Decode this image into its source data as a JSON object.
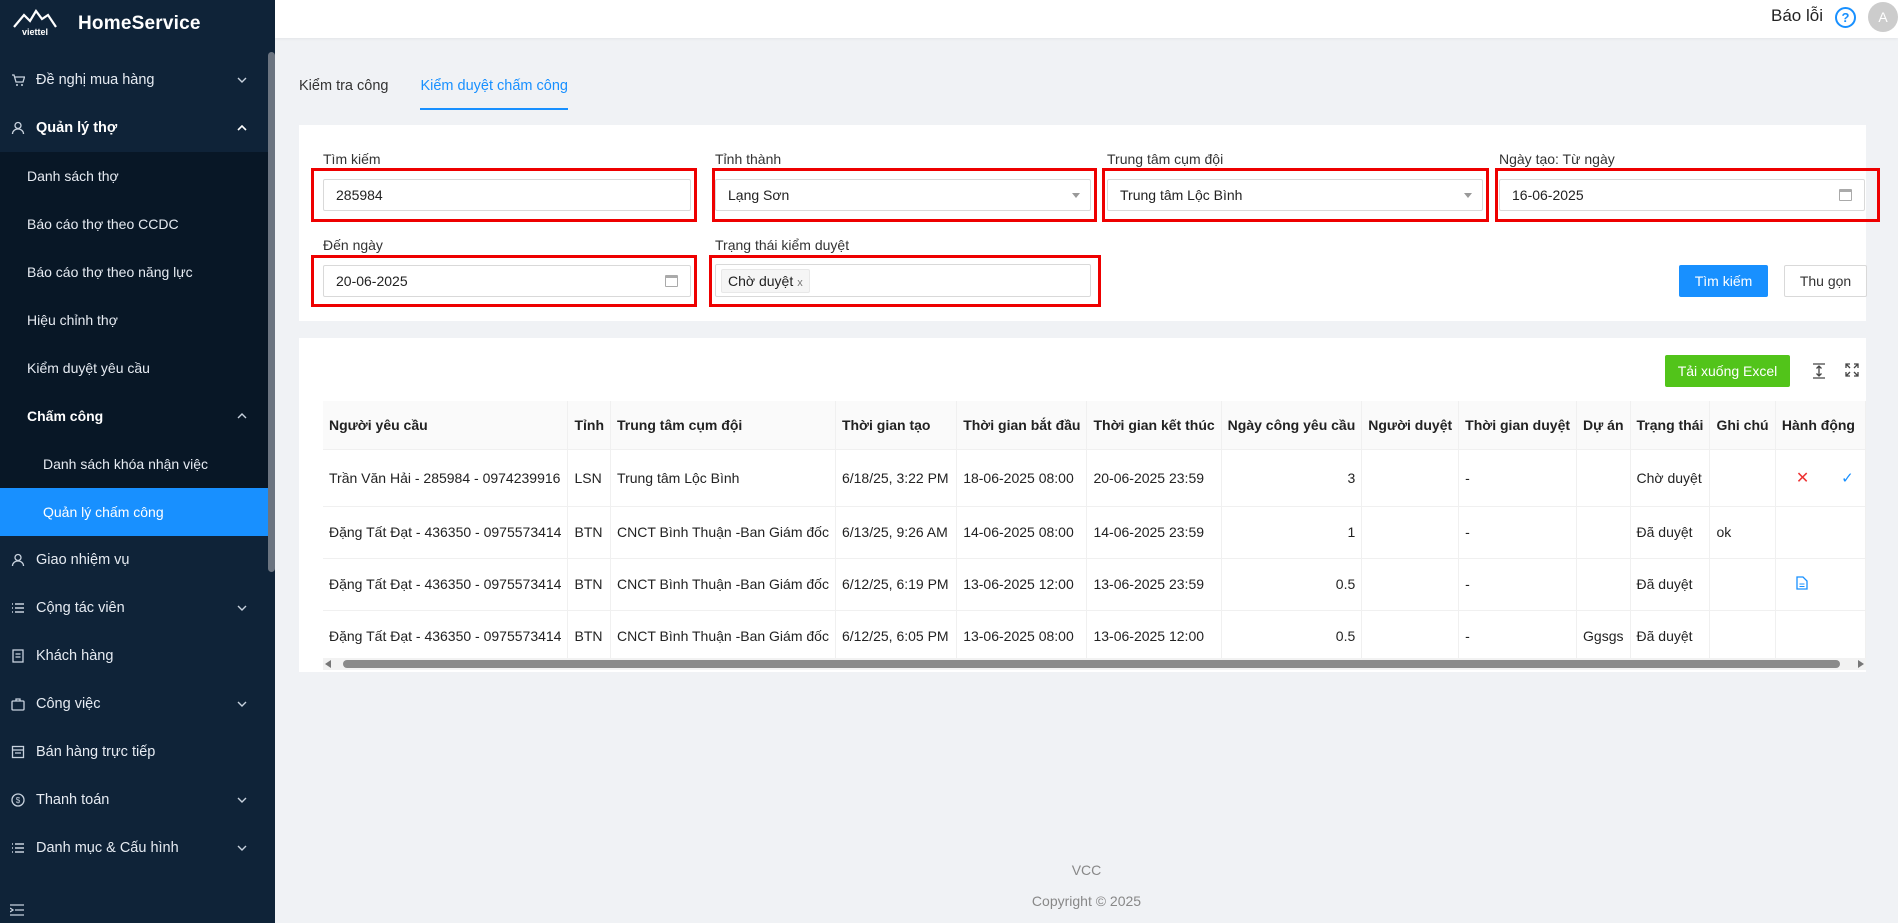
{
  "app": {
    "title": "HomeService",
    "logo_text": "viettel"
  },
  "sidebar": {
    "items": [
      {
        "label": "Đề nghị mua hàng",
        "icon": "cart-icon"
      },
      {
        "label": "Quản lý thợ",
        "icon": "user-icon"
      },
      {
        "label": "Danh sách thợ"
      },
      {
        "label": "Báo cáo thợ theo CCDC"
      },
      {
        "label": "Báo cáo thợ theo năng lực"
      },
      {
        "label": "Hiệu chỉnh thợ"
      },
      {
        "label": "Kiểm duyệt yêu cầu"
      },
      {
        "label": "Chấm công"
      },
      {
        "label": "Danh sách khóa nhận việc"
      },
      {
        "label": "Quản lý chấm công"
      },
      {
        "label": "Giao nhiệm vụ",
        "icon": "user-task-icon"
      },
      {
        "label": "Cộng tác viên",
        "icon": "list-icon"
      },
      {
        "label": "Khách hàng",
        "icon": "document-icon"
      },
      {
        "label": "Công việc",
        "icon": "bag-icon"
      },
      {
        "label": "Bán hàng trực tiếp",
        "icon": "store-icon"
      },
      {
        "label": "Thanh toán",
        "icon": "dollar-icon"
      },
      {
        "label": "Danh mục & Cấu hình",
        "icon": "list-icon"
      }
    ]
  },
  "header": {
    "report_label": "Báo lỗi",
    "help_glyph": "?",
    "avatar_letter": "A"
  },
  "tabs": [
    {
      "label": "Kiểm tra công"
    },
    {
      "label": "Kiểm duyệt chấm công"
    }
  ],
  "filters": {
    "search": {
      "label": "Tìm kiếm",
      "value": "285984"
    },
    "province": {
      "label": "Tỉnh thành",
      "value": "Lạng Sơn"
    },
    "center": {
      "label": "Trung tâm cụm đội",
      "value": "Trung tâm Lộc Bình"
    },
    "from_date": {
      "label": "Ngày tạo: Từ ngày",
      "value": "16-06-2025"
    },
    "to_date": {
      "label": "Đến ngày",
      "value": "20-06-2025"
    },
    "status": {
      "label": "Trạng thái kiểm duyệt",
      "tag": "Chờ duyệt",
      "tag_close": "x"
    },
    "search_button": "Tìm kiếm",
    "collapse_button": "Thu gọn"
  },
  "toolbar": {
    "excel_button": "Tải xuống Excel",
    "density_glyph": "⇕",
    "fullscreen_glyph": "⤢"
  },
  "table": {
    "headers": [
      "Người yêu cầu",
      "Tỉnh",
      "Trung tâm cụm đội",
      "Thời gian tạo",
      "Thời gian bắt đầu",
      "Thời gian kết thúc",
      "Ngày công yêu cầu",
      "Người duyệt",
      "Thời gian duyệt",
      "Dự án",
      "Trạng thái",
      "Ghi chú",
      "Hành động"
    ],
    "rows": [
      [
        "Trần Văn Hải - 285984 - 0974239916",
        "LSN",
        "Trung tâm Lộc Bình",
        "6/18/25, 3:22 PM",
        "18-06-2025 08:00",
        "20-06-2025 23:59",
        "3",
        "",
        "-",
        "",
        "Chờ duyệt",
        "",
        ""
      ],
      [
        "Đặng Tất Đạt - 436350 - 0975573414",
        "BTN",
        "CNCT Bình Thuận -Ban Giám đốc",
        "6/13/25, 9:26 AM",
        "14-06-2025 08:00",
        "14-06-2025 23:59",
        "1",
        "",
        "-",
        "",
        "Đã duyệt",
        "ok",
        ""
      ],
      [
        "Đặng Tất Đạt - 436350 - 0975573414",
        "BTN",
        "CNCT Bình Thuận -Ban Giám đốc",
        "6/12/25, 6:19 PM",
        "13-06-2025 12:00",
        "13-06-2025 23:59",
        "0.5",
        "",
        "-",
        "",
        "Đã duyệt",
        "",
        ""
      ],
      [
        "Đặng Tất Đạt - 436350 - 0975573414",
        "BTN",
        "CNCT Bình Thuận -Ban Giám đốc",
        "6/12/25, 6:05 PM",
        "13-06-2025 08:00",
        "13-06-2025 12:00",
        "0.5",
        "",
        "-",
        "Ggsgs",
        "Đã duyệt",
        "",
        ""
      ]
    ],
    "action_icons": {
      "reject": "✕",
      "approve": "✓"
    }
  },
  "footer": {
    "company": "VCC",
    "copyright": "Copyright © 2025"
  },
  "colors": {
    "primary": "#1890ff",
    "sidebar": "#0f2338",
    "success": "#52c41a",
    "highlight": "#e00000"
  }
}
